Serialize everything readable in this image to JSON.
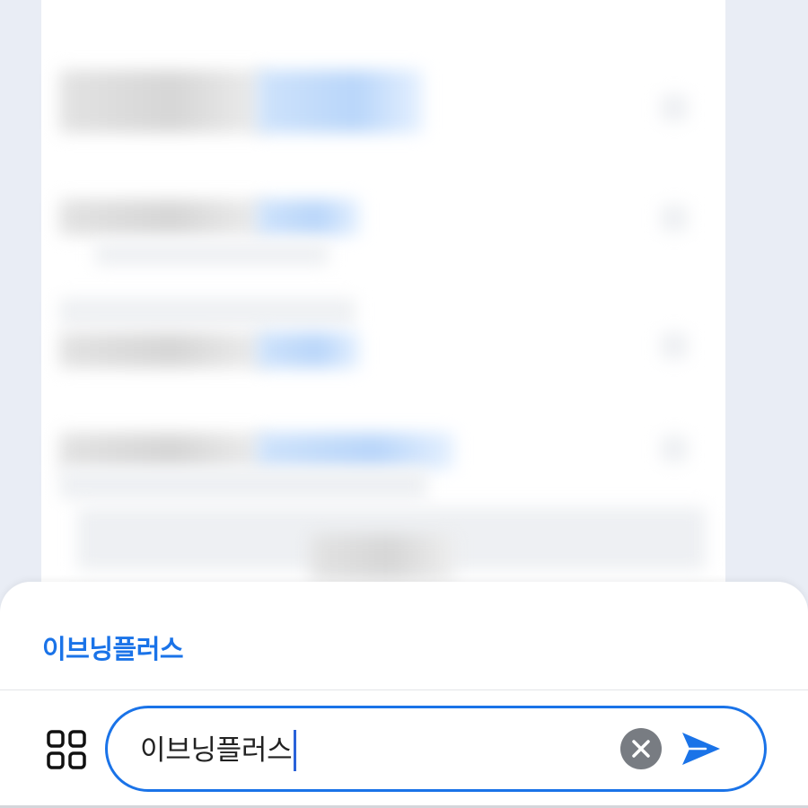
{
  "suggestion": {
    "label": "이브닝플러스"
  },
  "search": {
    "value": "이브닝플러스"
  },
  "icons": {
    "menu": "grid-icon",
    "clear": "close-circle-icon",
    "send": "send-arrow-icon"
  },
  "colors": {
    "accent": "#1a73e8",
    "clear_button": "#787c82",
    "background": "#e9edf5"
  }
}
